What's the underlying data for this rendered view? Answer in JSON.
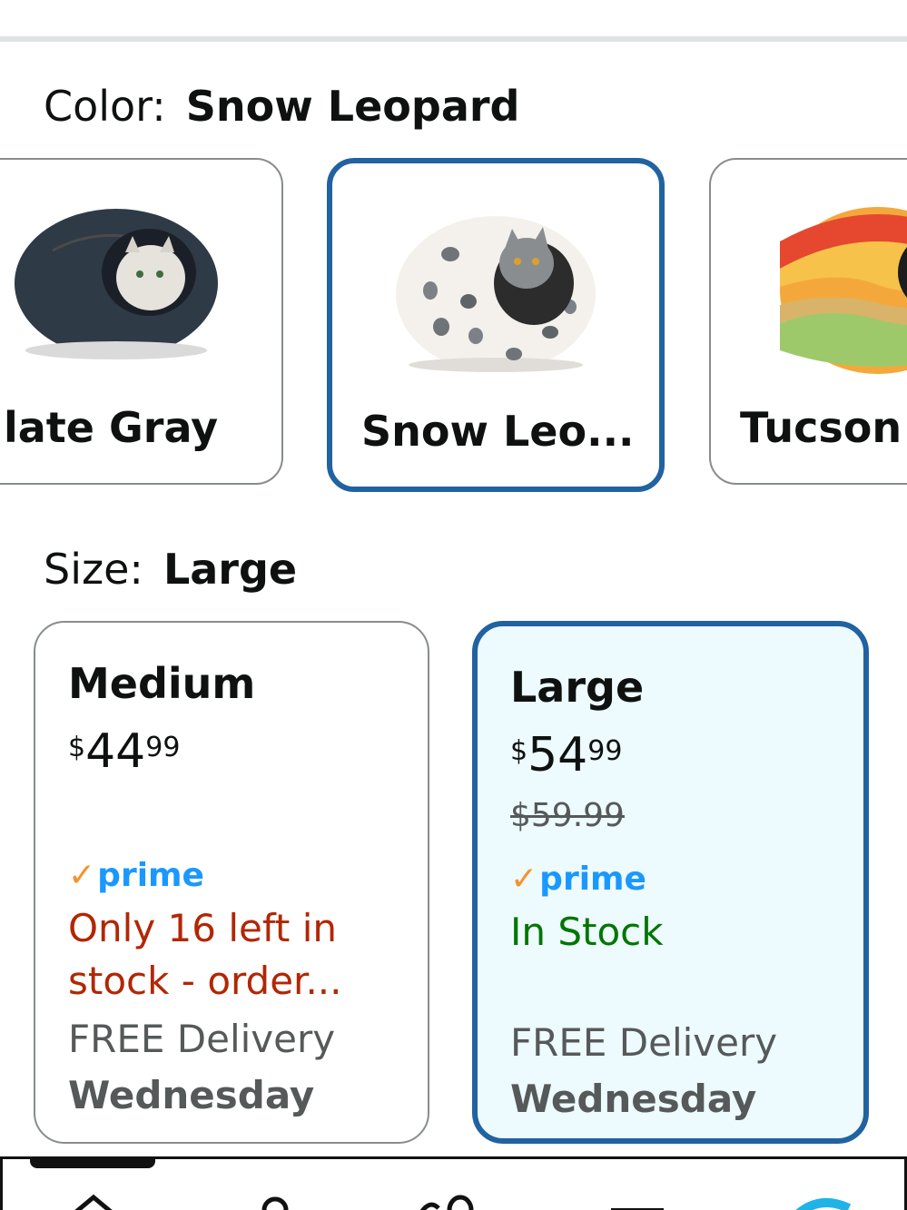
{
  "color": {
    "label": "Color:",
    "value": "Snow Leopard"
  },
  "color_swatches": [
    {
      "name": "late Gray",
      "selected": false
    },
    {
      "name": "Snow Leo...",
      "selected": true
    },
    {
      "name": "Tucson S",
      "selected": false
    }
  ],
  "size": {
    "label": "Size:",
    "value": "Large"
  },
  "size_options": [
    {
      "title": "Medium",
      "price_symbol": "$",
      "price_whole": "44",
      "price_fraction": "99",
      "list_price": "",
      "prime": "prime",
      "stock": "Only 16 left in stock - order...",
      "delivery": "FREE Delivery",
      "delivery_day": "Wednesday",
      "selected": false
    },
    {
      "title": "Large",
      "price_symbol": "$",
      "price_whole": "54",
      "price_fraction": "99",
      "list_price": "$59.99",
      "prime": "prime",
      "stock": "In Stock",
      "delivery": "FREE Delivery",
      "delivery_day": "Wednesday",
      "selected": true
    }
  ],
  "nav_icons": [
    "home-icon",
    "profile-icon",
    "cart-icon",
    "menu-icon",
    "assistant-icon"
  ],
  "colors": {
    "selected_border": "#2162a1",
    "prime_blue": "#1a98ff",
    "prime_check": "#f7922b",
    "low_stock": "#b12704",
    "in_stock": "#007600"
  }
}
